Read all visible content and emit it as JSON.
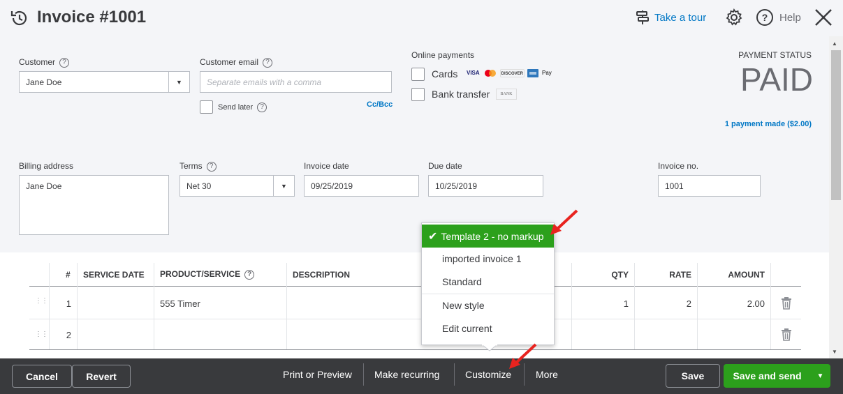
{
  "header": {
    "title": "Invoice #1001",
    "take_tour": "Take a tour",
    "help": "Help"
  },
  "customer": {
    "label": "Customer",
    "value": "Jane Doe"
  },
  "customer_email": {
    "label": "Customer email",
    "placeholder": "Separate emails with a comma",
    "send_later": "Send later",
    "cc_bcc": "Cc/Bcc"
  },
  "online_payments": {
    "label": "Online payments",
    "cards": "Cards",
    "bank_transfer": "Bank transfer",
    "bank_logo": "BANK",
    "card_logos": [
      "VISA",
      "mastercard",
      "DISCOVER",
      "AMEX",
      "Apple Pay"
    ]
  },
  "payment_status": {
    "label": "PAYMENT STATUS",
    "value": "PAID",
    "payment_link": "1 payment made ($2.00)"
  },
  "billing": {
    "label": "Billing address",
    "value": "Jane Doe"
  },
  "terms": {
    "label": "Terms",
    "value": "Net 30"
  },
  "invoice_date": {
    "label": "Invoice date",
    "value": "09/25/2019"
  },
  "due_date": {
    "label": "Due date",
    "value": "10/25/2019"
  },
  "invoice_no": {
    "label": "Invoice no.",
    "value": "1001"
  },
  "table": {
    "headers": {
      "num": "#",
      "service_date": "SERVICE DATE",
      "product": "PRODUCT/SERVICE",
      "description": "DESCRIPTION",
      "qty": "QTY",
      "rate": "RATE",
      "amount": "AMOUNT"
    },
    "rows": [
      {
        "num": "1",
        "product": "555 Timer",
        "qty": "1",
        "rate": "2",
        "amount": "2.00"
      },
      {
        "num": "2",
        "product": "",
        "qty": "",
        "rate": "",
        "amount": ""
      }
    ]
  },
  "customize_menu": {
    "items": [
      "Template 2 - no markup",
      "imported invoice 1",
      "Standard",
      "New style",
      "Edit current"
    ],
    "selected_index": 0
  },
  "footer": {
    "cancel": "Cancel",
    "revert": "Revert",
    "print_preview": "Print or Preview",
    "make_recurring": "Make recurring",
    "customize": "Customize",
    "more": "More",
    "save": "Save",
    "save_send": "Save and send"
  },
  "colors": {
    "brand_green": "#2ca01c",
    "link_blue": "#0077c5",
    "footer_bg": "#393a3d",
    "annotation_red": "#e8231f"
  }
}
